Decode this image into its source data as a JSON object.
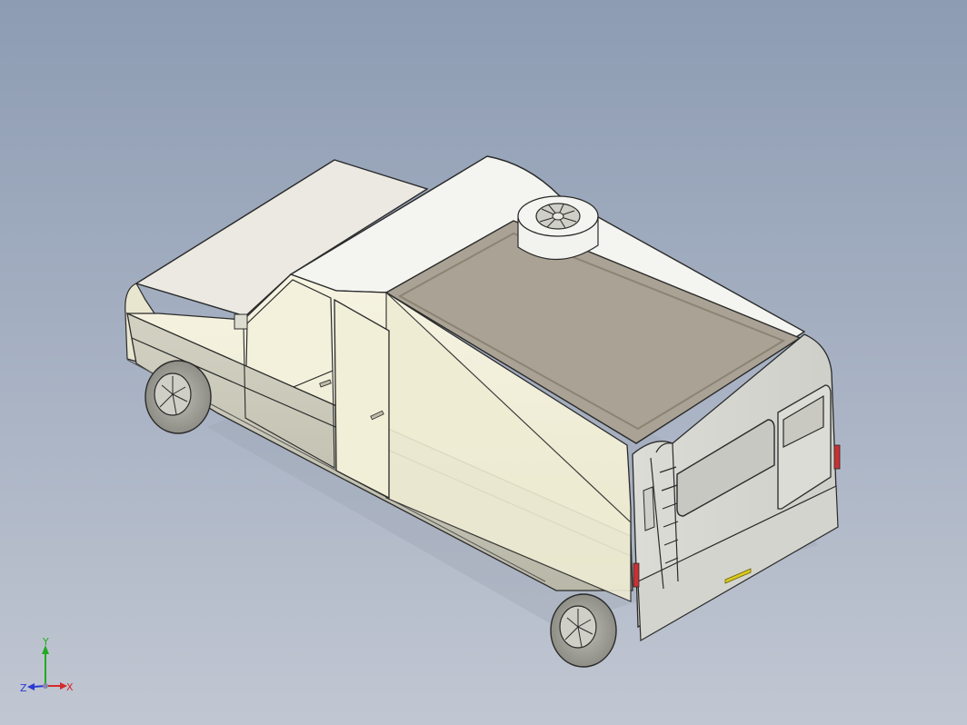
{
  "viewport": {
    "background_top": "#8d9cb3",
    "background_bottom": "#c1c7d2"
  },
  "model": {
    "subject": "camper van",
    "colors": {
      "body_cream": "#f2f0da",
      "body_lower_gray": "#c9c8b8",
      "roof_panel": "#aaa294",
      "edge": "#2a2a2a",
      "tail_light": "#c83232",
      "license_plate": "#d8c820"
    },
    "features": [
      "roof-hatch",
      "roof-fan",
      "side-door",
      "rear-door",
      "rear-ladder",
      "rear-window",
      "front-wheel",
      "rear-wheel",
      "side-mirror"
    ]
  },
  "triad": {
    "x_label": "X",
    "y_label": "Y",
    "z_label": "Z",
    "x_color": "#d42a2a",
    "y_color": "#22aa22",
    "z_color": "#2a3ad4"
  }
}
